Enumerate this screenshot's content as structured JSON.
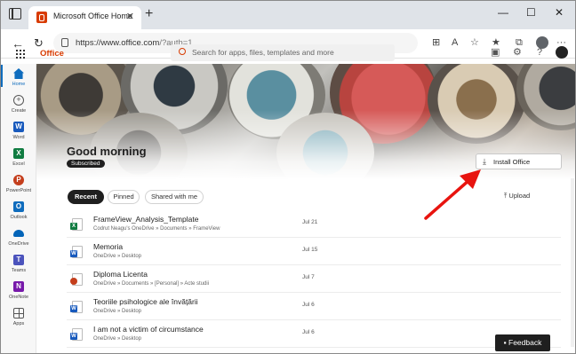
{
  "browser": {
    "tab_title": "Microsoft Office Home",
    "tab_close": "✕",
    "new_tab": "+",
    "url_host": "https://www.office.com",
    "url_path": "/?auth=1",
    "window_controls": [
      "—",
      "☐",
      "✕"
    ],
    "more": "···"
  },
  "header": {
    "brand": "Office",
    "search_placeholder": "Search for apps, files, templates and more"
  },
  "rail": [
    {
      "label": "Home",
      "color": "#0f6cbd",
      "icon": "home-icon"
    },
    {
      "label": "Create",
      "color": "#555555",
      "icon": "plus-icon"
    },
    {
      "label": "Word",
      "color": "#185abd",
      "icon": "word-icon"
    },
    {
      "label": "Excel",
      "color": "#107c41",
      "icon": "excel-icon"
    },
    {
      "label": "PowerPoint",
      "color": "#c43e1c",
      "icon": "powerpoint-icon"
    },
    {
      "label": "Outlook",
      "color": "#0f6cbd",
      "icon": "outlook-icon"
    },
    {
      "label": "OneDrive",
      "color": "#0364b8",
      "icon": "onedrive-icon"
    },
    {
      "label": "Teams",
      "color": "#4b53bc",
      "icon": "teams-icon"
    },
    {
      "label": "OneNote",
      "color": "#7719aa",
      "icon": "onenote-icon"
    },
    {
      "label": "Apps",
      "color": "#555555",
      "icon": "apps-icon"
    }
  ],
  "hero": {
    "greeting": "Good morning",
    "badge": "Subscribed",
    "install": "Install Office"
  },
  "filters": {
    "recent": "Recent",
    "pinned": "Pinned",
    "shared": "Shared with me",
    "upload": "Upload"
  },
  "files": [
    {
      "name": "FrameView_Analysis_Template",
      "path": "Codrut Neagu's OneDrive » Documents » FrameView",
      "date": "Jul 21",
      "type": "X",
      "color": "#107c41"
    },
    {
      "name": "Memoria",
      "path": "OneDrive » Desktop",
      "date": "Jul 15",
      "type": "W",
      "color": "#185abd"
    },
    {
      "name": "Diploma Licenta",
      "path": "OneDrive » Documents » [Personal] » Acte studii",
      "date": "Jul 7",
      "type": "",
      "color": "#c43e1c"
    },
    {
      "name": "Teoriile psihologice ale învățării",
      "path": "OneDrive » Desktop",
      "date": "Jul 6",
      "type": "W",
      "color": "#185abd"
    },
    {
      "name": "I am not a victim of circumstance",
      "path": "OneDrive » Desktop",
      "date": "Jul 6",
      "type": "W",
      "color": "#185abd"
    }
  ],
  "feedback": "Feedback",
  "colors": {
    "brand": "#d83b01",
    "accent": "#0f6cbd",
    "annotation_arrow": "#e8140f"
  }
}
